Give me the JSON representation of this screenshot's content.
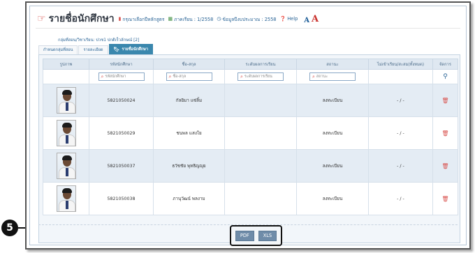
{
  "header": {
    "title": "รายชื่อนักศึกษา",
    "course_hint": "กรุณาเลือกปีหลักสูตร",
    "semester": "ภาคเรียน : 1/2558",
    "budget": "ข้อมูลปีงบประมาณ : 2558",
    "help": "Help",
    "font_small": "A",
    "font_large": "A"
  },
  "subject_line": "กลุ่มที่สอน/วิชาเรียน: ปวช1 ปกติเร็วลักษณ์ [2]",
  "tabs": [
    {
      "label": "กำหนดกลุ่มที่สอน"
    },
    {
      "label": "รายละเอียด"
    },
    {
      "label": "รายชื่อนักศึกษา"
    }
  ],
  "table": {
    "columns": [
      "รูปภาพ",
      "รหัสนักศึกษา",
      "ชื่อ-สกุล",
      "ระดับผลการเรียน",
      "สถานะ",
      "ไม่เข้าเรียน/สะสม(ทั้งหมด)",
      "จัดการ"
    ],
    "filters": {
      "student_id": "รหัสนักศึกษา",
      "name": "ชื่อ-สกุล",
      "grade": "ระดับผลการเรียน",
      "status": "สถานะ"
    },
    "rows": [
      {
        "id": "5821050024",
        "name": "กัลยิมา แซ่ลิ้ม",
        "grade": "",
        "status": "ลงทะเบียน",
        "absence": "- / -"
      },
      {
        "id": "5821050029",
        "name": "ชนพล แสงใย",
        "grade": "",
        "status": "ลงทะเบียน",
        "absence": "- / -"
      },
      {
        "id": "5821050037",
        "name": "ธวัชชัย พุทธิญญุย",
        "grade": "",
        "status": "ลงทะเบียน",
        "absence": "- / -"
      },
      {
        "id": "5821050038",
        "name": "ภานุวัฒน์ พลงาม",
        "grade": "",
        "status": "ลงทะเบียน",
        "absence": "- / -"
      }
    ]
  },
  "export": {
    "pdf": "PDF",
    "xls": "XLS"
  },
  "callout": {
    "number": "5"
  }
}
